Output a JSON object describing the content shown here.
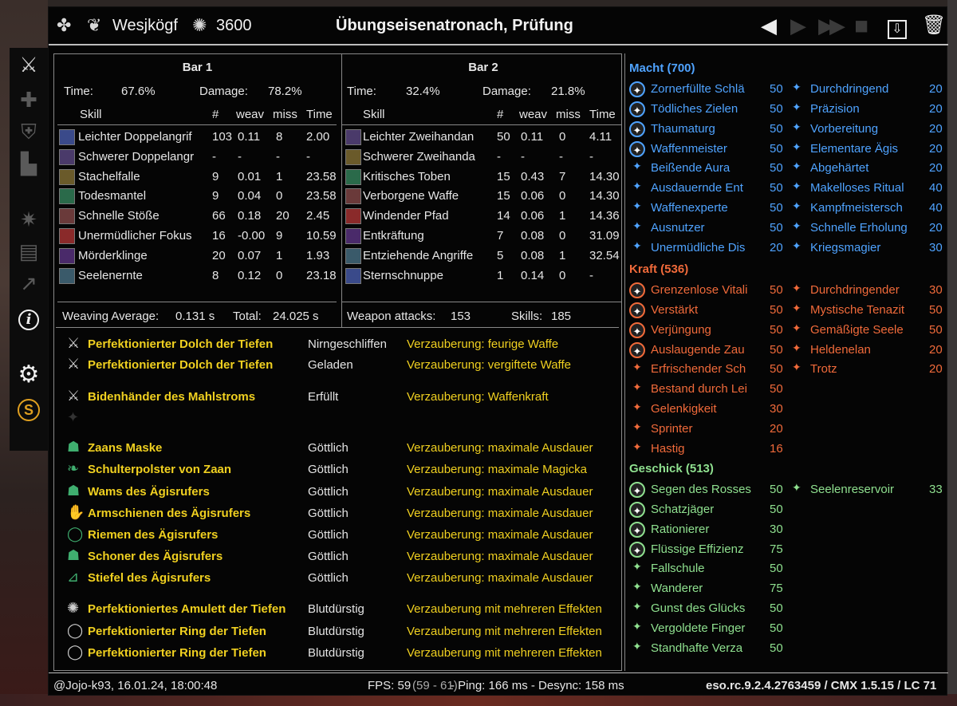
{
  "colors": {
    "blue": "#4fa3ff",
    "red": "#f06a3a",
    "green": "#8fe08f",
    "gold": "#f0d020",
    "bg": "#050505"
  },
  "titlebar": {
    "player_icon": "eso-class-icon",
    "player_name": "Wesjkögf",
    "score_icon": "cp-score-icon",
    "score": "3600",
    "title": "Übungseisenatronach, Prüfung",
    "buttons": [
      "prev-icon",
      "next-icon",
      "last-icon",
      "camera-icon",
      "save-icon",
      "trash-icon"
    ]
  },
  "left_icons": [
    "weapon-icon",
    "heal-icon",
    "shield-icon",
    "buff-icon",
    "skills-icon",
    "log-icon",
    "graph-icon",
    "info-icon",
    "settings-icon",
    "esoui-icon"
  ],
  "bars": [
    {
      "title": "Bar 1",
      "time_label": "Time:",
      "time": "67.6%",
      "damage_label": "Damage:",
      "damage": "78.2%",
      "headers": {
        "skill": "Skill",
        "num": "#",
        "weav": "weav",
        "miss": "miss",
        "time": "Time"
      },
      "rows": [
        {
          "name": "Leichter Doppelangrif",
          "n": "103",
          "weav": "0.11",
          "miss": "8",
          "time": "2.00"
        },
        {
          "name": "Schwerer Doppelangr",
          "n": "-",
          "weav": "-",
          "miss": "-",
          "time": "-"
        },
        {
          "name": "Stachelfalle",
          "n": "9",
          "weav": "0.01",
          "miss": "1",
          "time": "23.58"
        },
        {
          "name": "Todesmantel",
          "n": "9",
          "weav": "0.04",
          "miss": "0",
          "time": "23.58"
        },
        {
          "name": "Schnelle Stöße",
          "n": "66",
          "weav": "0.18",
          "miss": "20",
          "time": "2.45"
        },
        {
          "name": "Unermüdlicher Fokus",
          "n": "16",
          "weav": "-0.00",
          "miss": "9",
          "time": "10.59"
        },
        {
          "name": "Mörderklinge",
          "n": "20",
          "weav": "0.07",
          "miss": "1",
          "time": "1.93"
        },
        {
          "name": "Seelenernte",
          "n": "8",
          "weav": "0.12",
          "miss": "0",
          "time": "23.18"
        }
      ],
      "footer_left": "Weaving Average:",
      "footer_left_val": "0.131 s",
      "footer_right": "Total:",
      "footer_right_val": "24.025 s"
    },
    {
      "title": "Bar 2",
      "time_label": "Time:",
      "time": "32.4%",
      "damage_label": "Damage:",
      "damage": "21.8%",
      "headers": {
        "skill": "Skill",
        "num": "#",
        "weav": "weav",
        "miss": "miss",
        "time": "Time"
      },
      "rows": [
        {
          "name": "Leichter Zweihandan",
          "n": "50",
          "weav": "0.11",
          "miss": "0",
          "time": "4.11"
        },
        {
          "name": "Schwerer Zweihanda",
          "n": "-",
          "weav": "-",
          "miss": "-",
          "time": "-"
        },
        {
          "name": "Kritisches Toben",
          "n": "15",
          "weav": "0.43",
          "miss": "7",
          "time": "14.30"
        },
        {
          "name": "Verborgene Waffe",
          "n": "15",
          "weav": "0.06",
          "miss": "0",
          "time": "14.30"
        },
        {
          "name": "Windender Pfad",
          "n": "14",
          "weav": "0.06",
          "miss": "1",
          "time": "14.36"
        },
        {
          "name": "Entkräftung",
          "n": "7",
          "weav": "0.08",
          "miss": "0",
          "time": "31.09"
        },
        {
          "name": "Entziehende Angriffe",
          "n": "5",
          "weav": "0.08",
          "miss": "1",
          "time": "32.54"
        },
        {
          "name": "Sternschnuppe",
          "n": "1",
          "weav": "0.14",
          "miss": "0",
          "time": "-"
        }
      ],
      "footer_left": "Weapon attacks:",
      "footer_left_val": "153",
      "footer_right": "Skills:",
      "footer_right_val": "185"
    }
  ],
  "gear": [
    {
      "icon": "dagger-icon",
      "name": "Perfektionierter Dolch der Tiefen",
      "trait": "Nirngeschliffen",
      "ench": "Verzauberung: feurige Waffe"
    },
    {
      "icon": "dagger-icon",
      "name": "Perfektionierter Dolch der Tiefen",
      "trait": "Geladen",
      "ench": "Verzauberung: vergiftete Waffe"
    },
    {
      "icon": "sword-icon",
      "name": "Bidenhänder des Mahlstroms",
      "trait": "Erfüllt",
      "ench": "Verzauberung: Waffenkraft"
    },
    {
      "icon": "empty-slot-icon",
      "name": "",
      "trait": "",
      "ench": ""
    },
    {
      "icon": "helm-icon",
      "name": "Zaans Maske",
      "trait": "Göttlich",
      "ench": "Verzauberung: maximale Ausdauer"
    },
    {
      "icon": "shoulder-icon",
      "name": "Schulterpolster von Zaan",
      "trait": "Göttlich",
      "ench": "Verzauberung: maximale Magicka"
    },
    {
      "icon": "chest-icon",
      "name": "Wams des Ägisrufers",
      "trait": "Göttlich",
      "ench": "Verzauberung: maximale Ausdauer"
    },
    {
      "icon": "gloves-icon",
      "name": "Armschienen des Ägisrufers",
      "trait": "Göttlich",
      "ench": "Verzauberung: maximale Ausdauer"
    },
    {
      "icon": "belt-icon",
      "name": "Riemen des Ägisrufers",
      "trait": "Göttlich",
      "ench": "Verzauberung: maximale Ausdauer"
    },
    {
      "icon": "legs-icon",
      "name": "Schoner des Ägisrufers",
      "trait": "Göttlich",
      "ench": "Verzauberung: maximale Ausdauer"
    },
    {
      "icon": "boots-icon",
      "name": "Stiefel des Ägisrufers",
      "trait": "Göttlich",
      "ench": "Verzauberung: maximale Ausdauer"
    },
    {
      "icon": "amulet-icon",
      "name": "Perfektioniertes Amulett der Tiefen",
      "trait": "Blutdürstig",
      "ench": "Verzauberung mit mehreren Effekten"
    },
    {
      "icon": "ring-icon",
      "name": "Perfektionierter Ring der Tiefen",
      "trait": "Blutdürstig",
      "ench": "Verzauberung mit mehreren Effekten"
    },
    {
      "icon": "ring-icon",
      "name": "Perfektionierter Ring der Tiefen",
      "trait": "Blutdürstig",
      "ench": "Verzauberung mit mehreren Effekten"
    }
  ],
  "cp": {
    "macht": {
      "title": "Macht (700)",
      "left": [
        {
          "n": "Zornerfüllte Schlä",
          "v": "50",
          "slot": true
        },
        {
          "n": "Tödliches Zielen",
          "v": "50",
          "slot": true
        },
        {
          "n": "Thaumaturg",
          "v": "50",
          "slot": true
        },
        {
          "n": "Waffenmeister",
          "v": "50",
          "slot": true
        },
        {
          "n": "Beißende Aura",
          "v": "50"
        },
        {
          "n": "Ausdauernde Ent",
          "v": "50"
        },
        {
          "n": "Waffenexperte",
          "v": "50"
        },
        {
          "n": "Ausnutzer",
          "v": "50"
        },
        {
          "n": "Unermüdliche Dis",
          "v": "20"
        }
      ],
      "right": [
        {
          "n": "Durchdringend",
          "v": "20"
        },
        {
          "n": "Präzision",
          "v": "20"
        },
        {
          "n": "Vorbereitung",
          "v": "20"
        },
        {
          "n": "Elementare Ägis",
          "v": "20"
        },
        {
          "n": "Abgehärtet",
          "v": "20"
        },
        {
          "n": "Makelloses Ritual",
          "v": "40"
        },
        {
          "n": "Kampfmeistersch",
          "v": "40"
        },
        {
          "n": "Schnelle Erholung",
          "v": "20"
        },
        {
          "n": "Kriegsmagier",
          "v": "30"
        }
      ]
    },
    "kraft": {
      "title": "Kraft (536)",
      "left": [
        {
          "n": "Grenzenlose Vitali",
          "v": "50",
          "slot": true
        },
        {
          "n": "Verstärkt",
          "v": "50",
          "slot": true
        },
        {
          "n": "Verjüngung",
          "v": "50",
          "slot": true
        },
        {
          "n": "Auslaugende Zau",
          "v": "50",
          "slot": true
        },
        {
          "n": "Erfrischender Sch",
          "v": "50"
        },
        {
          "n": "Bestand durch Lei",
          "v": "50"
        },
        {
          "n": "Gelenkigkeit",
          "v": "30"
        },
        {
          "n": "Sprinter",
          "v": "20"
        },
        {
          "n": "Hastig",
          "v": "16"
        }
      ],
      "right": [
        {
          "n": "Durchdringender",
          "v": "30"
        },
        {
          "n": "Mystische Tenazit",
          "v": "50"
        },
        {
          "n": "Gemäßigte Seele",
          "v": "50"
        },
        {
          "n": "Heldenelan",
          "v": "20"
        },
        {
          "n": "Trotz",
          "v": "20"
        }
      ]
    },
    "geschick": {
      "title": "Geschick (513)",
      "left": [
        {
          "n": "Segen des Rosses",
          "v": "50",
          "slot": true
        },
        {
          "n": "Schatzjäger",
          "v": "50",
          "slot": true
        },
        {
          "n": "Rationierer",
          "v": "30",
          "slot": true
        },
        {
          "n": "Flüssige Effizienz",
          "v": "75",
          "slot": true
        },
        {
          "n": "Fallschule",
          "v": "50"
        },
        {
          "n": "Wanderer",
          "v": "75"
        },
        {
          "n": "Gunst des Glücks",
          "v": "50"
        },
        {
          "n": "Vergoldete Finger",
          "v": "50"
        },
        {
          "n": "Standhafte Verza",
          "v": "50"
        }
      ],
      "right": [
        {
          "n": "Seelenreservoir",
          "v": "33"
        }
      ]
    }
  },
  "footer": {
    "left": "@Jojo-k93, 16.01.24, 18:00:48",
    "fps": "FPS: 59",
    "fps_range": "(59 - 61)",
    "ping": "- Ping: 166 ms - Desync: 158 ms",
    "version": "eso.rc.9.2.4.2763459 / CMX 1.5.15 / LC 71"
  }
}
